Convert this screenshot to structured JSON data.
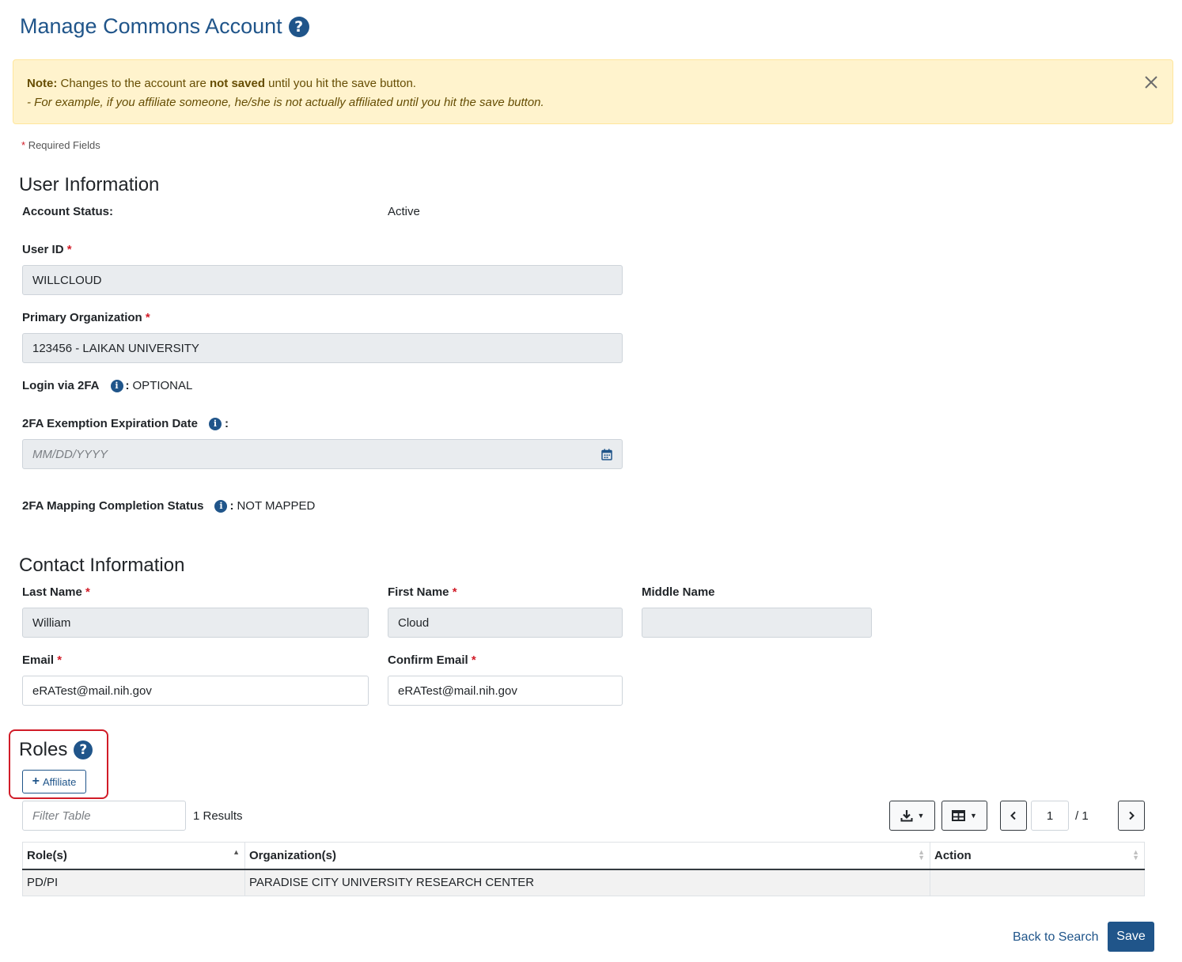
{
  "page": {
    "title": "Manage Commons Account"
  },
  "note": {
    "label": "Note:",
    "text_before": " Changes to the account are ",
    "bold": "not saved",
    "text_after": " until you hit the save button.",
    "example": "- For example, if you affiliate someone, he/she is not actually affiliated until you hit the save button."
  },
  "required_note": {
    "star": "*",
    "text": "Required Fields"
  },
  "user_info": {
    "heading": "User Information",
    "account_status_label": "Account Status:",
    "account_status_value": "Active",
    "user_id_label": "User ID",
    "user_id_value": "WILLCLOUD",
    "primary_org_label": "Primary Organization",
    "primary_org_value": "123456 - LAIKAN UNIVERSITY",
    "login_2fa_label": "Login via 2FA",
    "login_2fa_value": "OPTIONAL",
    "exemption_label": "2FA Exemption Expiration Date",
    "exemption_placeholder": "MM/DD/YYYY",
    "mapping_label": "2FA Mapping Completion Status",
    "mapping_value": "NOT MAPPED"
  },
  "contact_info": {
    "heading": "Contact Information",
    "last_name_label": "Last Name",
    "last_name_value": "William",
    "first_name_label": "First Name",
    "first_name_value": "Cloud",
    "middle_name_label": "Middle Name",
    "middle_name_value": "",
    "email_label": "Email",
    "email_value": "eRATest@mail.nih.gov",
    "confirm_email_label": "Confirm Email",
    "confirm_email_value": "eRATest@mail.nih.gov"
  },
  "roles": {
    "heading": "Roles",
    "affiliate_label": "Affiliate",
    "filter_placeholder": "Filter Table",
    "results_text": "1 Results",
    "page_current": "1",
    "page_total": "/ 1",
    "columns": [
      "Role(s)",
      "Organization(s)",
      "Action"
    ],
    "rows": [
      [
        "PD/PI",
        "PARADISE CITY UNIVERSITY RESEARCH CENTER",
        ""
      ]
    ]
  },
  "footer": {
    "back_label": "Back to Search",
    "save_label": "Save"
  },
  "colors": {
    "brand": "#20558a",
    "note_bg": "#fff3cd",
    "required": "#d11c28",
    "highlight": "#d11c28"
  }
}
